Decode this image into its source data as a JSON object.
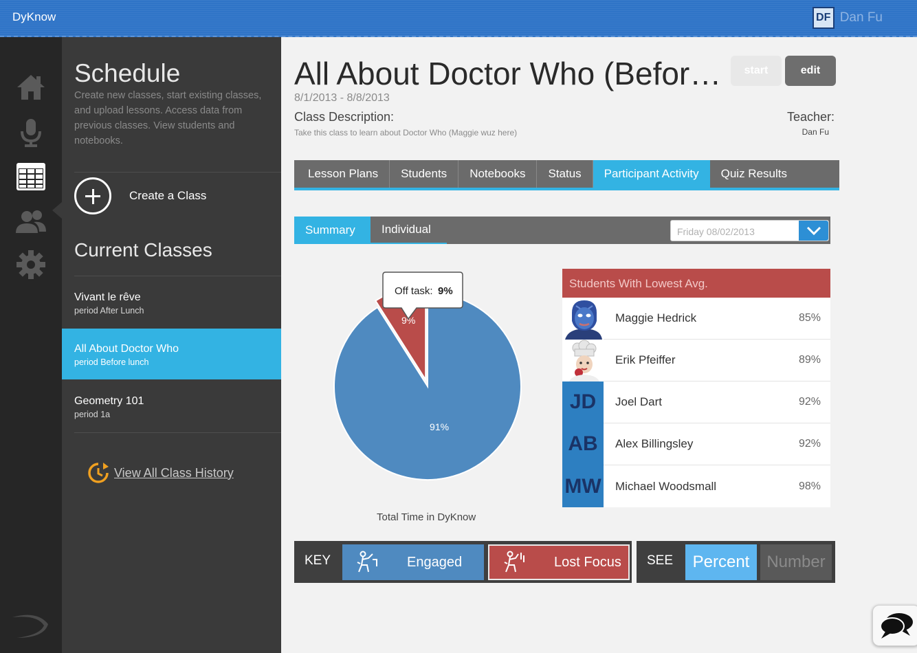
{
  "app": {
    "title": "DyKnow"
  },
  "user": {
    "initials": "DF",
    "name": "Dan Fu"
  },
  "rail": {
    "icons": [
      "home-icon",
      "microphone-icon",
      "schedule-icon",
      "users-icon",
      "settings-icon"
    ],
    "active": "schedule-icon"
  },
  "sidebar": {
    "title": "Schedule",
    "description": "Create new classes, start existing classes, and upload lessons. Access data from previous classes. View students and notebooks.",
    "create_label": "Create a Class",
    "current_title": "Current Classes",
    "classes": [
      {
        "name": "Vivant le rêve",
        "period": "period After Lunch",
        "active": false
      },
      {
        "name": "All About Doctor Who",
        "period": "period Before lunch",
        "active": true
      },
      {
        "name": "Geometry 101",
        "period": "period 1a",
        "active": false
      }
    ],
    "history_label": "View All Class History"
  },
  "class": {
    "title": "All About Doctor Who (Befor…",
    "dates": "8/1/2013 - 8/8/2013",
    "description_label": "Class Description:",
    "description": "Take this class to learn about Doctor Who (Maggie wuz here)",
    "teacher_label": "Teacher:",
    "teacher": "Dan Fu"
  },
  "actions": {
    "start_label": "start",
    "edit_label": "edit"
  },
  "tabs": [
    {
      "label": "Lesson Plans",
      "active": false
    },
    {
      "label": "Students",
      "active": false
    },
    {
      "label": "Notebooks",
      "active": false
    },
    {
      "label": "Status",
      "active": false
    },
    {
      "label": "Participant Activity",
      "active": true
    },
    {
      "label": "Quiz Results",
      "active": false
    }
  ],
  "subtabs": {
    "summary": "Summary",
    "individual": "Individual",
    "active": "summary"
  },
  "date_select": {
    "value": "Friday 08/02/2013"
  },
  "chart_data": {
    "type": "pie",
    "labels": [
      "Engaged",
      "Lost Focus"
    ],
    "values": [
      91,
      9
    ],
    "value_labels": [
      "91%",
      "9%"
    ],
    "colors": [
      "#4f8ac0",
      "#b94c4a"
    ],
    "caption": "Total Time in DyKnow",
    "tooltip": {
      "label": "Off task:",
      "value": "9%"
    }
  },
  "lowest": {
    "title": "Students With Lowest Avg.",
    "students": [
      {
        "name": "Maggie Hedrick",
        "score": "85%",
        "avatar": "blue-face-avatar"
      },
      {
        "name": "Erik Pfeiffer",
        "score": "89%",
        "avatar": "chef-avatar"
      },
      {
        "name": "Joel Dart",
        "score": "92%",
        "initials": "JD"
      },
      {
        "name": "Alex Billingsley",
        "score": "92%",
        "initials": "AB"
      },
      {
        "name": "Michael Woodsmall",
        "score": "98%",
        "initials": "MW"
      }
    ]
  },
  "key": {
    "label": "KEY",
    "engaged": "Engaged",
    "lost": "Lost Focus"
  },
  "see": {
    "label": "SEE",
    "percent": "Percent",
    "number": "Number",
    "active": "percent"
  }
}
